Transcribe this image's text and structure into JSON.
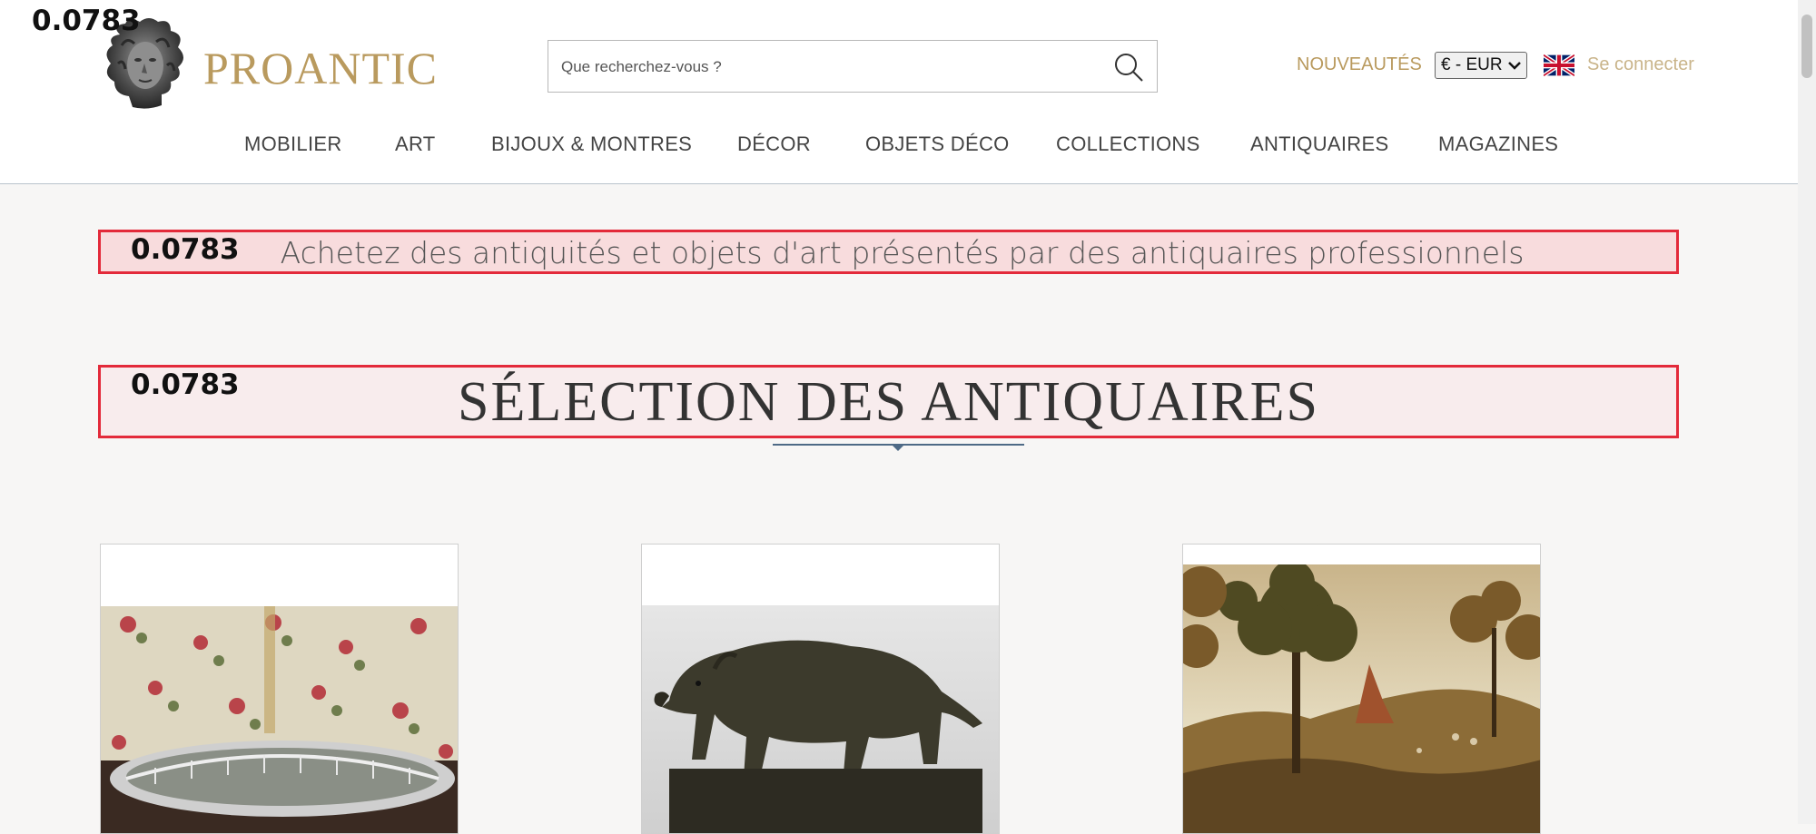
{
  "overlay": {
    "score": "0.0783"
  },
  "logo": {
    "text": "PROANTIC"
  },
  "search": {
    "placeholder": "Que recherchez-vous ?"
  },
  "header": {
    "new_label": "NOUVEAUTÉS",
    "currency": "€ - EUR",
    "language_icon": "uk-flag-icon",
    "login_label": "Se connecter"
  },
  "nav": {
    "items": [
      {
        "label": "MOBILIER"
      },
      {
        "label": "ART"
      },
      {
        "label": "BIJOUX & MONTRES"
      },
      {
        "label": "DÉCOR"
      },
      {
        "label": "OBJETS DÉCO"
      },
      {
        "label": "COLLECTIONS"
      },
      {
        "label": "ANTIQUAIRES"
      },
      {
        "label": "MAGAZINES"
      }
    ]
  },
  "banner": {
    "text": "Achetez des antiquités et objets d'art présentés par des antiquaires professionnels"
  },
  "section": {
    "title": "SÉLECTION DES ANTIQUAIRES"
  },
  "products": [
    {
      "image": "silver-mirror-tray-image"
    },
    {
      "image": "bronze-boar-sculpture-image"
    },
    {
      "image": "landscape-painting-image"
    }
  ],
  "colors": {
    "brand_gold": "#b99a5e",
    "login_gold": "#c9b48a",
    "highlight_border": "#e32a3a",
    "page_bg": "#f7f6f5"
  }
}
